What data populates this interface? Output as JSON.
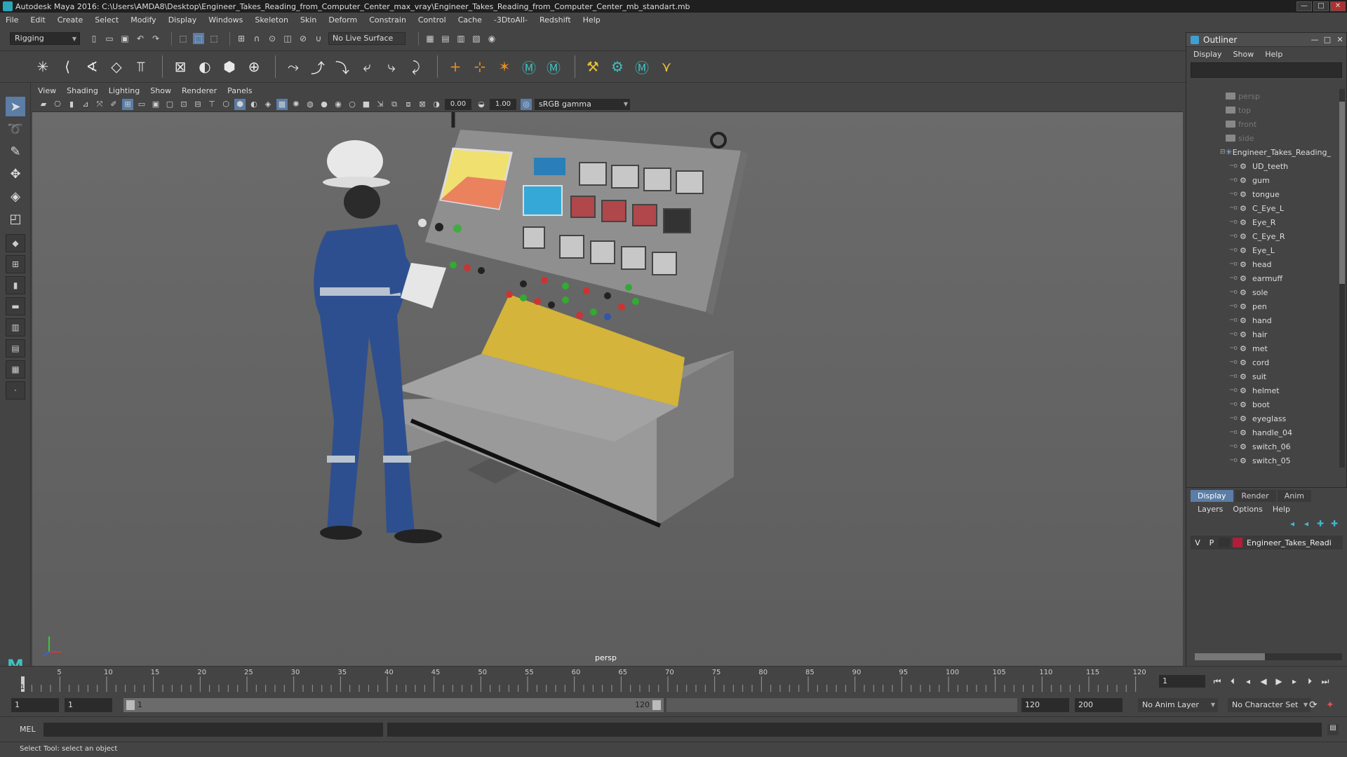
{
  "window": {
    "title": "Autodesk Maya 2016: C:\\Users\\AMDA8\\Desktop\\Engineer_Takes_Reading_from_Computer_Center_max_vray\\Engineer_Takes_Reading_from_Computer_Center_mb_standart.mb"
  },
  "menubar": [
    "File",
    "Edit",
    "Create",
    "Select",
    "Modify",
    "Display",
    "Windows",
    "Skeleton",
    "Skin",
    "Deform",
    "Constrain",
    "Control",
    "Cache",
    "-3DtoAll-",
    "Redshift",
    "Help"
  ],
  "statusline": {
    "mode": "Rigging",
    "live_surface": "No Live Surface"
  },
  "viewport": {
    "menu": [
      "View",
      "Shading",
      "Lighting",
      "Show",
      "Renderer",
      "Panels"
    ],
    "field_a": "0.00",
    "field_b": "1.00",
    "color_space": "sRGB gamma",
    "camera_label": "persp"
  },
  "outliner": {
    "title": "Outliner",
    "menu": [
      "Display",
      "Show",
      "Help"
    ],
    "cameras": [
      "persp",
      "top",
      "front",
      "side"
    ],
    "root": "Engineer_Takes_Reading_",
    "children": [
      "UD_teeth",
      "gum",
      "tongue",
      "C_Eye_L",
      "Eye_R",
      "C_Eye_R",
      "Eye_L",
      "head",
      "earmuff",
      "sole",
      "pen",
      "hand",
      "hair",
      "met",
      "cord",
      "suit",
      "helmet",
      "boot",
      "eyeglass",
      "handle_04",
      "switch_06",
      "switch_05"
    ]
  },
  "layers": {
    "tabs": [
      "Display",
      "Render",
      "Anim"
    ],
    "menu": [
      "Layers",
      "Options",
      "Help"
    ],
    "row": {
      "v": "V",
      "p": "P",
      "name": "Engineer_Takes_Readi"
    },
    "color": "#b01e3a"
  },
  "timeline": {
    "ticks": [
      "5",
      "10",
      "15",
      "20",
      "25",
      "30",
      "35",
      "40",
      "45",
      "50",
      "55",
      "60",
      "65",
      "70",
      "75",
      "80",
      "85",
      "90",
      "95",
      "100",
      "105",
      "110",
      "115",
      "120"
    ],
    "first": "1",
    "current_frame": "1"
  },
  "range": {
    "start_a": "1",
    "start_b": "1",
    "bar_start": "1",
    "bar_end": "120",
    "end_a": "120",
    "end_b": "200",
    "anim_layer": "No Anim Layer",
    "char_set": "No Character Set"
  },
  "command": {
    "label": "MEL"
  },
  "help": {
    "text": "Select Tool: select an object"
  }
}
